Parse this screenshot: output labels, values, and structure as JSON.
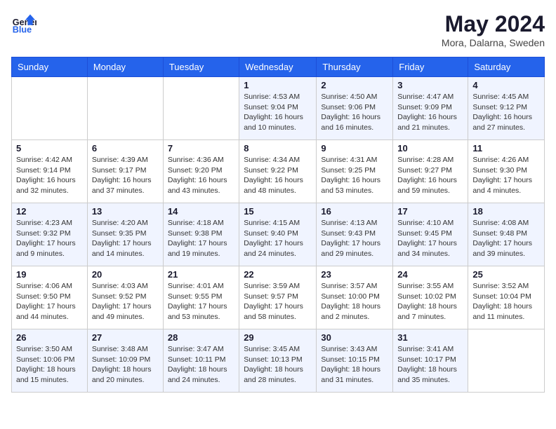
{
  "header": {
    "logo_general": "General",
    "logo_blue": "Blue",
    "month_year": "May 2024",
    "location": "Mora, Dalarna, Sweden"
  },
  "weekdays": [
    "Sunday",
    "Monday",
    "Tuesday",
    "Wednesday",
    "Thursday",
    "Friday",
    "Saturday"
  ],
  "weeks": [
    [
      {
        "day": "",
        "info": ""
      },
      {
        "day": "",
        "info": ""
      },
      {
        "day": "",
        "info": ""
      },
      {
        "day": "1",
        "info": "Sunrise: 4:53 AM\nSunset: 9:04 PM\nDaylight: 16 hours\nand 10 minutes."
      },
      {
        "day": "2",
        "info": "Sunrise: 4:50 AM\nSunset: 9:06 PM\nDaylight: 16 hours\nand 16 minutes."
      },
      {
        "day": "3",
        "info": "Sunrise: 4:47 AM\nSunset: 9:09 PM\nDaylight: 16 hours\nand 21 minutes."
      },
      {
        "day": "4",
        "info": "Sunrise: 4:45 AM\nSunset: 9:12 PM\nDaylight: 16 hours\nand 27 minutes."
      }
    ],
    [
      {
        "day": "5",
        "info": "Sunrise: 4:42 AM\nSunset: 9:14 PM\nDaylight: 16 hours\nand 32 minutes."
      },
      {
        "day": "6",
        "info": "Sunrise: 4:39 AM\nSunset: 9:17 PM\nDaylight: 16 hours\nand 37 minutes."
      },
      {
        "day": "7",
        "info": "Sunrise: 4:36 AM\nSunset: 9:20 PM\nDaylight: 16 hours\nand 43 minutes."
      },
      {
        "day": "8",
        "info": "Sunrise: 4:34 AM\nSunset: 9:22 PM\nDaylight: 16 hours\nand 48 minutes."
      },
      {
        "day": "9",
        "info": "Sunrise: 4:31 AM\nSunset: 9:25 PM\nDaylight: 16 hours\nand 53 minutes."
      },
      {
        "day": "10",
        "info": "Sunrise: 4:28 AM\nSunset: 9:27 PM\nDaylight: 16 hours\nand 59 minutes."
      },
      {
        "day": "11",
        "info": "Sunrise: 4:26 AM\nSunset: 9:30 PM\nDaylight: 17 hours\nand 4 minutes."
      }
    ],
    [
      {
        "day": "12",
        "info": "Sunrise: 4:23 AM\nSunset: 9:32 PM\nDaylight: 17 hours\nand 9 minutes."
      },
      {
        "day": "13",
        "info": "Sunrise: 4:20 AM\nSunset: 9:35 PM\nDaylight: 17 hours\nand 14 minutes."
      },
      {
        "day": "14",
        "info": "Sunrise: 4:18 AM\nSunset: 9:38 PM\nDaylight: 17 hours\nand 19 minutes."
      },
      {
        "day": "15",
        "info": "Sunrise: 4:15 AM\nSunset: 9:40 PM\nDaylight: 17 hours\nand 24 minutes."
      },
      {
        "day": "16",
        "info": "Sunrise: 4:13 AM\nSunset: 9:43 PM\nDaylight: 17 hours\nand 29 minutes."
      },
      {
        "day": "17",
        "info": "Sunrise: 4:10 AM\nSunset: 9:45 PM\nDaylight: 17 hours\nand 34 minutes."
      },
      {
        "day": "18",
        "info": "Sunrise: 4:08 AM\nSunset: 9:48 PM\nDaylight: 17 hours\nand 39 minutes."
      }
    ],
    [
      {
        "day": "19",
        "info": "Sunrise: 4:06 AM\nSunset: 9:50 PM\nDaylight: 17 hours\nand 44 minutes."
      },
      {
        "day": "20",
        "info": "Sunrise: 4:03 AM\nSunset: 9:52 PM\nDaylight: 17 hours\nand 49 minutes."
      },
      {
        "day": "21",
        "info": "Sunrise: 4:01 AM\nSunset: 9:55 PM\nDaylight: 17 hours\nand 53 minutes."
      },
      {
        "day": "22",
        "info": "Sunrise: 3:59 AM\nSunset: 9:57 PM\nDaylight: 17 hours\nand 58 minutes."
      },
      {
        "day": "23",
        "info": "Sunrise: 3:57 AM\nSunset: 10:00 PM\nDaylight: 18 hours\nand 2 minutes."
      },
      {
        "day": "24",
        "info": "Sunrise: 3:55 AM\nSunset: 10:02 PM\nDaylight: 18 hours\nand 7 minutes."
      },
      {
        "day": "25",
        "info": "Sunrise: 3:52 AM\nSunset: 10:04 PM\nDaylight: 18 hours\nand 11 minutes."
      }
    ],
    [
      {
        "day": "26",
        "info": "Sunrise: 3:50 AM\nSunset: 10:06 PM\nDaylight: 18 hours\nand 15 minutes."
      },
      {
        "day": "27",
        "info": "Sunrise: 3:48 AM\nSunset: 10:09 PM\nDaylight: 18 hours\nand 20 minutes."
      },
      {
        "day": "28",
        "info": "Sunrise: 3:47 AM\nSunset: 10:11 PM\nDaylight: 18 hours\nand 24 minutes."
      },
      {
        "day": "29",
        "info": "Sunrise: 3:45 AM\nSunset: 10:13 PM\nDaylight: 18 hours\nand 28 minutes."
      },
      {
        "day": "30",
        "info": "Sunrise: 3:43 AM\nSunset: 10:15 PM\nDaylight: 18 hours\nand 31 minutes."
      },
      {
        "day": "31",
        "info": "Sunrise: 3:41 AM\nSunset: 10:17 PM\nDaylight: 18 hours\nand 35 minutes."
      },
      {
        "day": "",
        "info": ""
      }
    ]
  ]
}
